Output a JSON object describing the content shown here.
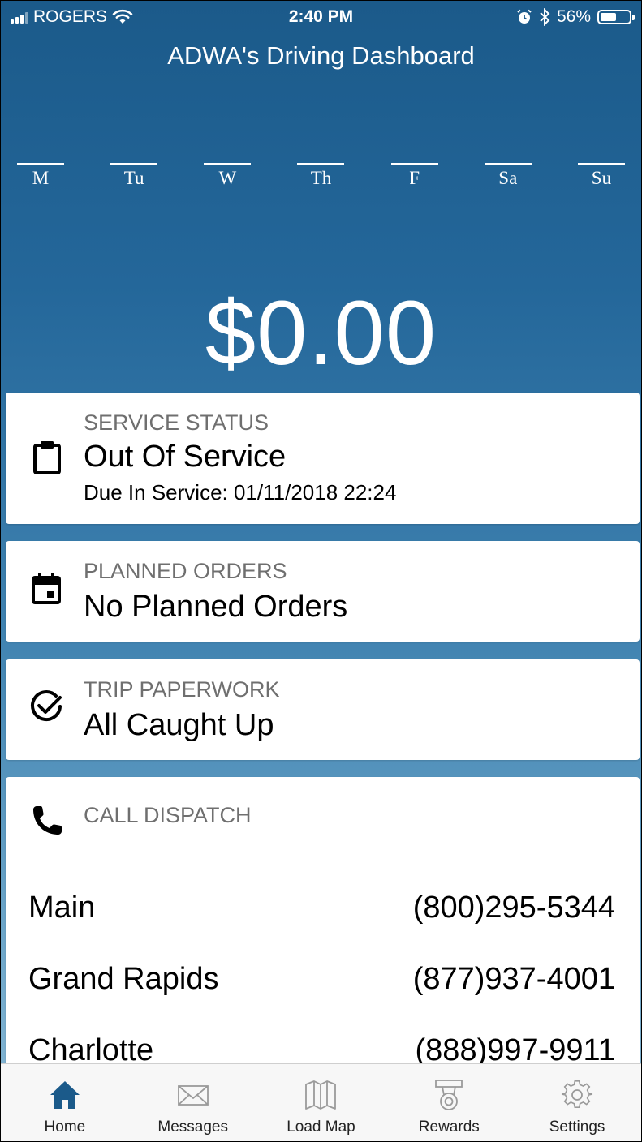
{
  "status_bar": {
    "carrier": "ROGERS",
    "time": "2:40 PM",
    "battery": "56%",
    "battery_level": 0.56
  },
  "title": "ADWA's Driving Dashboard",
  "week_days": [
    "M",
    "Tu",
    "W",
    "Th",
    "F",
    "Sa",
    "Su"
  ],
  "total": "$0.00",
  "service_status": {
    "label": "SERVICE STATUS",
    "value": "Out Of Service",
    "sub": "Due In Service: 01/11/2018 22:24"
  },
  "planned_orders": {
    "label": "PLANNED ORDERS",
    "value": "No Planned Orders"
  },
  "trip_paperwork": {
    "label": "TRIP PAPERWORK",
    "value": "All Caught Up"
  },
  "call_dispatch": {
    "label": "CALL DISPATCH",
    "contacts": [
      {
        "name": "Main",
        "phone": "(800)295-5344"
      },
      {
        "name": "Grand Rapids",
        "phone": "(877)937-4001"
      },
      {
        "name": "Charlotte",
        "phone": "(888)997-9911"
      }
    ]
  },
  "tabs": [
    {
      "label": "Home",
      "icon": "home-icon",
      "active": true
    },
    {
      "label": "Messages",
      "icon": "mail-icon",
      "active": false
    },
    {
      "label": "Load Map",
      "icon": "map-icon",
      "active": false
    },
    {
      "label": "Rewards",
      "icon": "badge-icon",
      "active": false
    },
    {
      "label": "Settings",
      "icon": "gear-icon",
      "active": false
    }
  ],
  "colors": {
    "accent": "#1b5a8a",
    "inactive_icon": "#9a9a9a",
    "label_gray": "#6f6f6f"
  }
}
